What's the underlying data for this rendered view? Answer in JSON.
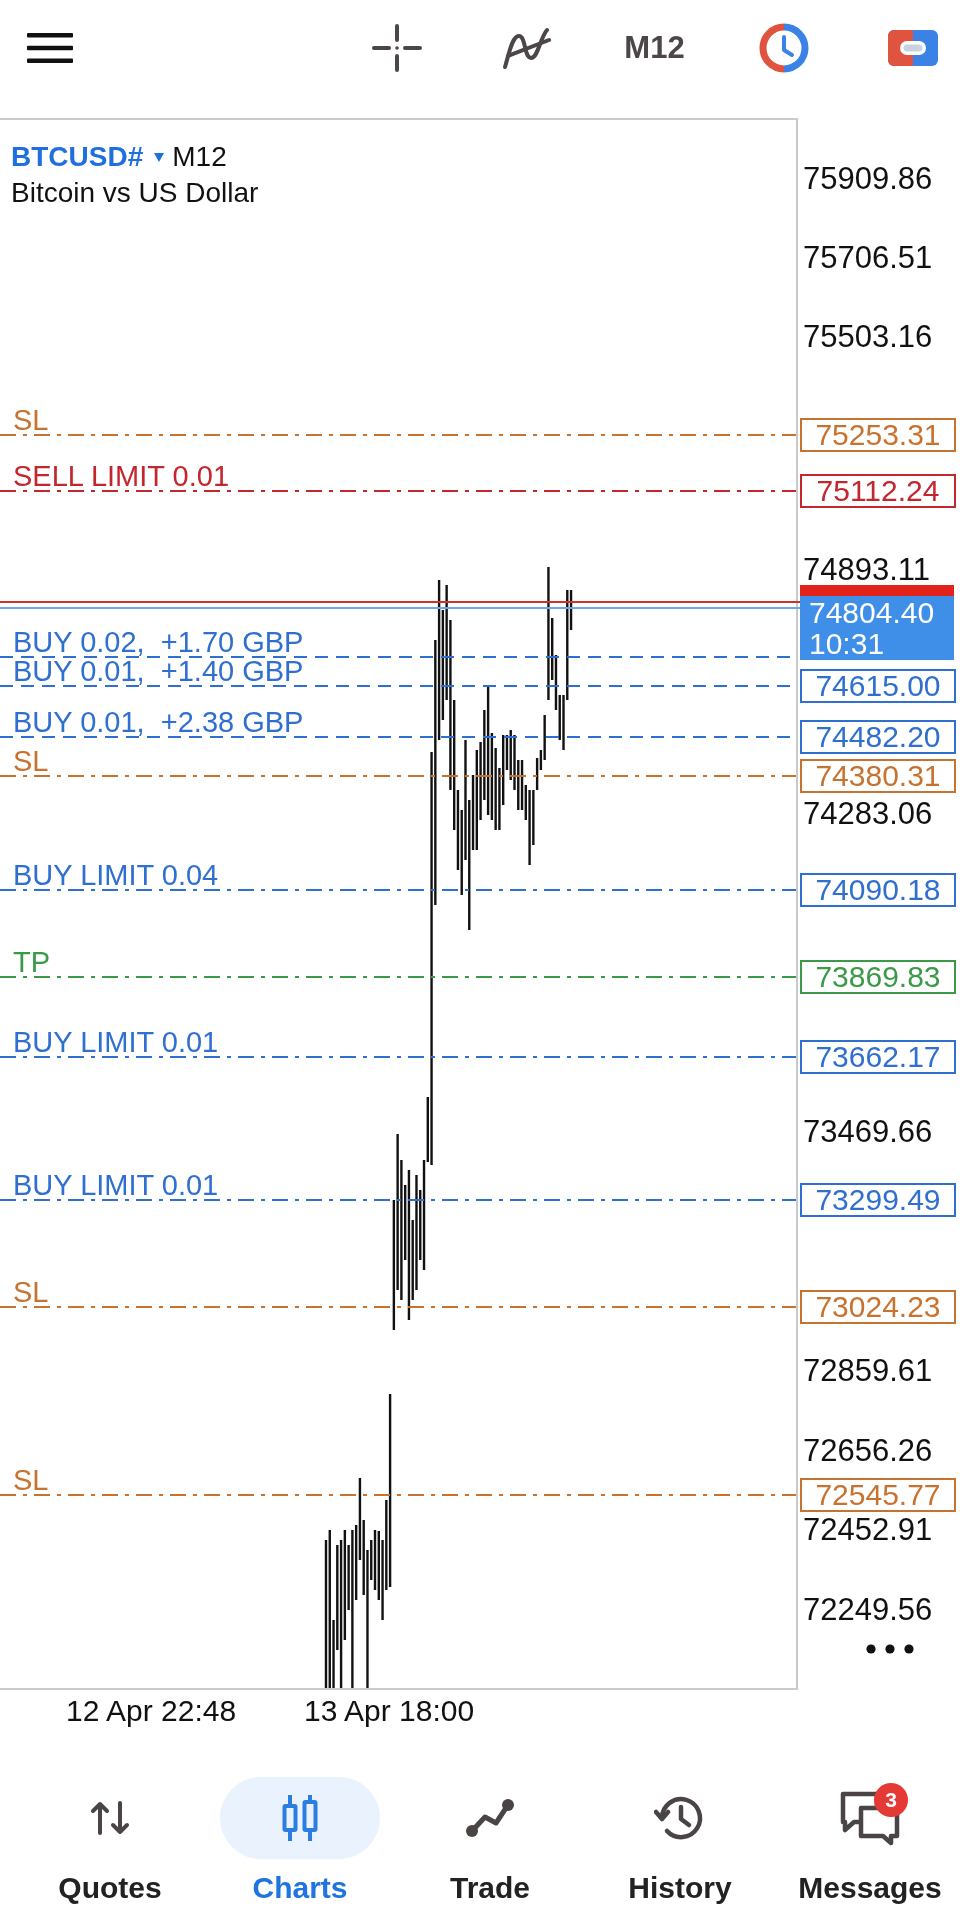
{
  "toolbar": {
    "timeframe": "M12"
  },
  "chart": {
    "symbol": "BTCUSD#",
    "timeframe": "M12",
    "description": "Bitcoin vs US Dollar",
    "price_ticks": [
      "75909.86",
      "75706.51",
      "75503.16",
      "74893.11",
      "74283.06",
      "73469.66",
      "72859.61",
      "72656.26",
      "72452.91",
      "72249.56"
    ],
    "levels": [
      {
        "kind": "order",
        "label": "SL",
        "price": "75253.31",
        "color": "#c8722f"
      },
      {
        "kind": "order",
        "label": "SELL LIMIT 0.01",
        "price": "75112.24",
        "color": "#c4262e"
      },
      {
        "kind": "position",
        "label": "BUY 0.02,  +1.70 GBP",
        "color": "#2f6fd0"
      },
      {
        "kind": "position",
        "label": "BUY 0.01,  +1.40 GBP",
        "price": "74615.00",
        "color": "#2f6fd0"
      },
      {
        "kind": "position",
        "label": "BUY 0.01,  +2.38 GBP",
        "price": "74482.20",
        "color": "#2f6fd0"
      },
      {
        "kind": "order",
        "label": "SL",
        "price": "74380.31",
        "color": "#c8722f"
      },
      {
        "kind": "order",
        "label": "BUY LIMIT 0.04",
        "price": "74090.18",
        "color": "#2f6fd0"
      },
      {
        "kind": "order",
        "label": "TP",
        "price": "73869.83",
        "color": "#3a9a47"
      },
      {
        "kind": "order",
        "label": "BUY LIMIT 0.01",
        "price": "73662.17",
        "color": "#2f6fd0"
      },
      {
        "kind": "order",
        "label": "BUY LIMIT 0.01",
        "price": "73299.49",
        "color": "#2f6fd0"
      },
      {
        "kind": "order",
        "label": "SL",
        "price": "73024.23",
        "color": "#c8722f"
      },
      {
        "kind": "order",
        "label": "SL",
        "price": "72545.77",
        "color": "#c8722f"
      }
    ],
    "bid": {
      "price": "74804.40",
      "countdown": "10:31"
    },
    "time_labels": [
      "12 Apr 22:48",
      "13 Apr 18:00"
    ]
  },
  "nav": [
    {
      "label": "Quotes",
      "selected": false
    },
    {
      "label": "Charts",
      "selected": true
    },
    {
      "label": "Trade",
      "selected": false
    },
    {
      "label": "History",
      "selected": false
    },
    {
      "label": "Messages",
      "selected": false,
      "badge": "3"
    }
  ]
}
